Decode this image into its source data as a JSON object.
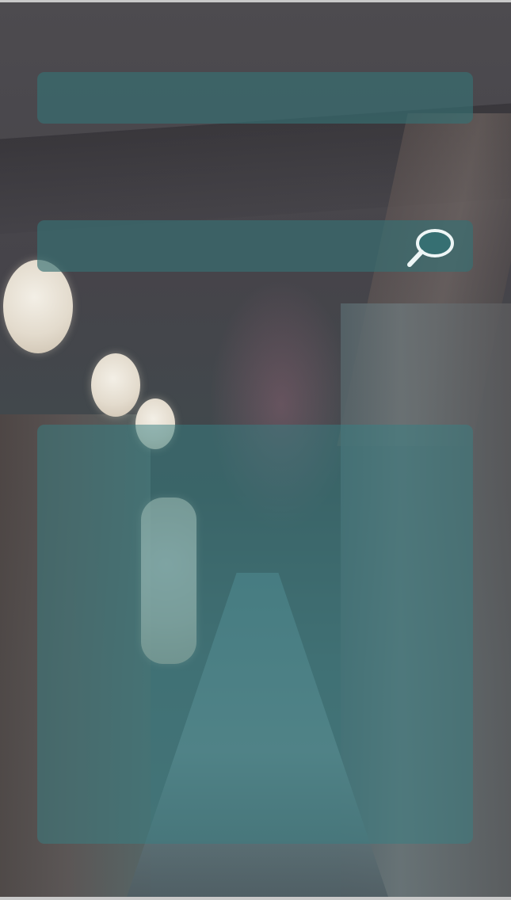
{
  "top_panel": {
    "text": ""
  },
  "search": {
    "value": "",
    "placeholder": "",
    "icon": "search-icon"
  },
  "content": {
    "items": []
  },
  "colors": {
    "panel_teal": "#367073",
    "icon_stroke": "#eef6f6"
  }
}
